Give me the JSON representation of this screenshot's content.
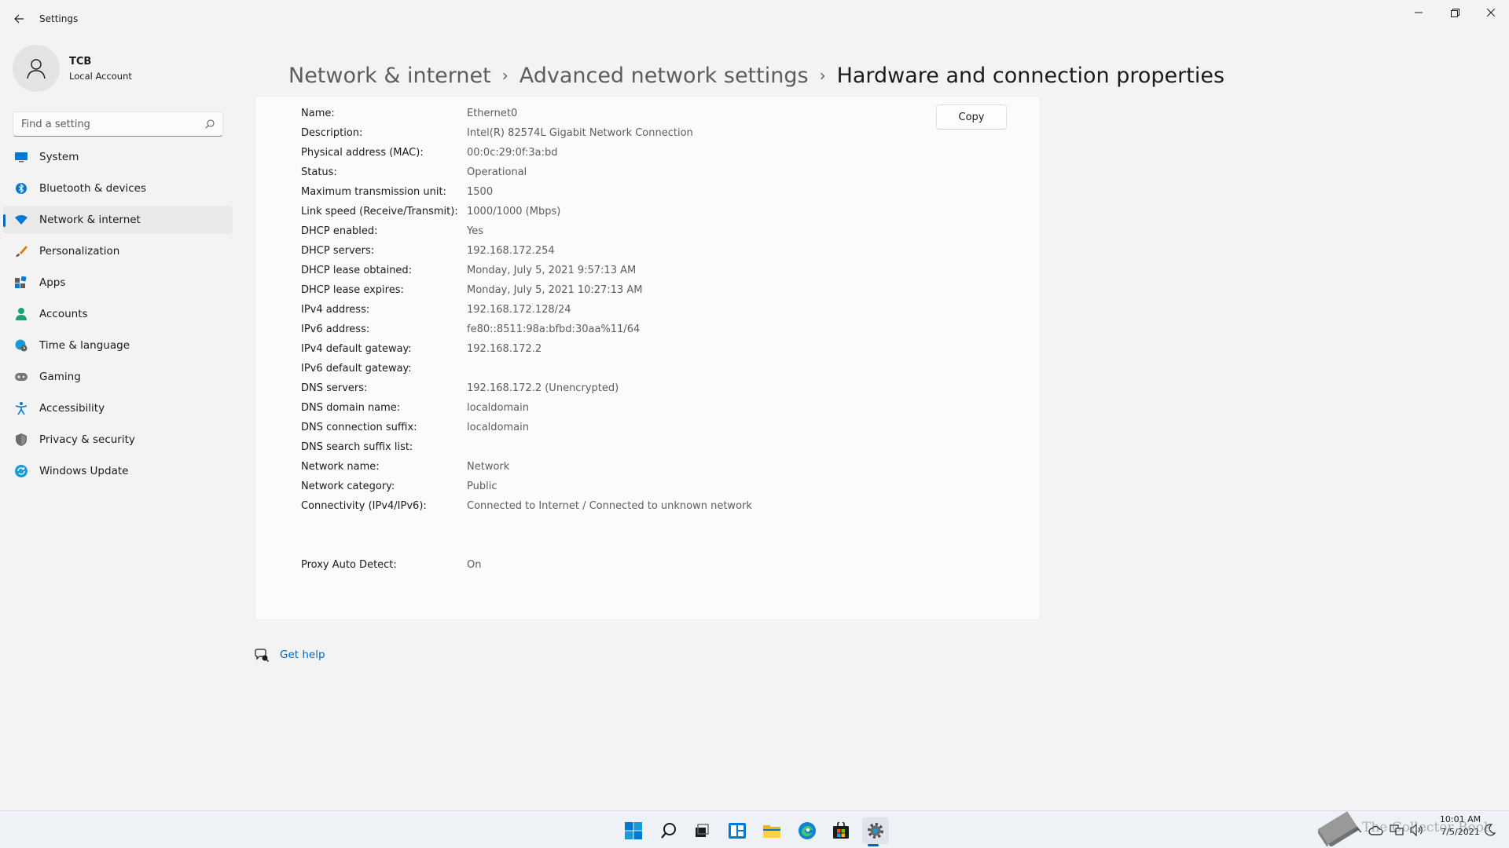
{
  "window": {
    "title": "Settings",
    "colors": {
      "accent": "#0067c0",
      "background": "#f3f3f3",
      "card": "#fbfbfb"
    }
  },
  "profile": {
    "name": "TCB",
    "account_type": "Local Account"
  },
  "search": {
    "placeholder": "Find a setting"
  },
  "sidebar": {
    "items": [
      {
        "label": "System",
        "icon": "monitor-icon"
      },
      {
        "label": "Bluetooth & devices",
        "icon": "bluetooth-icon"
      },
      {
        "label": "Network & internet",
        "icon": "wifi-icon",
        "active": true
      },
      {
        "label": "Personalization",
        "icon": "brush-icon"
      },
      {
        "label": "Apps",
        "icon": "apps-icon"
      },
      {
        "label": "Accounts",
        "icon": "person-icon"
      },
      {
        "label": "Time & language",
        "icon": "globe-clock-icon"
      },
      {
        "label": "Gaming",
        "icon": "gamepad-icon"
      },
      {
        "label": "Accessibility",
        "icon": "accessibility-icon"
      },
      {
        "label": "Privacy & security",
        "icon": "shield-icon"
      },
      {
        "label": "Windows Update",
        "icon": "update-icon"
      }
    ]
  },
  "breadcrumb": {
    "items": [
      "Network & internet",
      "Advanced network settings"
    ],
    "current": "Hardware and connection properties"
  },
  "properties": {
    "copy_label": "Copy",
    "rows": [
      {
        "label": "Name:",
        "value": "Ethernet0"
      },
      {
        "label": "Description:",
        "value": "Intel(R) 82574L Gigabit Network Connection"
      },
      {
        "label": "Physical address (MAC):",
        "value": "00:0c:29:0f:3a:bd"
      },
      {
        "label": "Status:",
        "value": "Operational"
      },
      {
        "label": "Maximum transmission unit:",
        "value": "1500"
      },
      {
        "label": "Link speed (Receive/Transmit):",
        "value": "1000/1000 (Mbps)"
      },
      {
        "label": "DHCP enabled:",
        "value": "Yes"
      },
      {
        "label": "DHCP servers:",
        "value": "192.168.172.254"
      },
      {
        "label": "DHCP lease obtained:",
        "value": "Monday, July 5, 2021 9:57:13 AM"
      },
      {
        "label": "DHCP lease expires:",
        "value": "Monday, July 5, 2021 10:27:13 AM"
      },
      {
        "label": "IPv4 address:",
        "value": "192.168.172.128/24"
      },
      {
        "label": "IPv6 address:",
        "value": "fe80::8511:98a:bfbd:30aa%11/64"
      },
      {
        "label": "IPv4 default gateway:",
        "value": "192.168.172.2"
      },
      {
        "label": "IPv6 default gateway:",
        "value": ""
      },
      {
        "label": "DNS servers:",
        "value": "192.168.172.2 (Unencrypted)"
      },
      {
        "label": "DNS domain name:",
        "value": "localdomain"
      },
      {
        "label": "DNS connection suffix:",
        "value": "localdomain"
      },
      {
        "label": "DNS search suffix list:",
        "value": ""
      },
      {
        "label": "Network name:",
        "value": "Network"
      },
      {
        "label": "Network category:",
        "value": "Public"
      },
      {
        "label": "Connectivity (IPv4/IPv6):",
        "value": "Connected to Internet / Connected to unknown network"
      },
      {
        "label": "",
        "value": ""
      },
      {
        "label": "",
        "value": ""
      },
      {
        "label": "Proxy Auto Detect:",
        "value": "On"
      }
    ]
  },
  "help": {
    "label": "Get help"
  },
  "taskbar": {
    "apps": [
      "start-icon",
      "search-icon",
      "task-view-icon",
      "widgets-icon",
      "file-explorer-icon",
      "edge-icon",
      "store-icon",
      "settings-icon"
    ],
    "clock_time": "10:01 AM",
    "clock_date": "7/5/2021"
  },
  "watermark": {
    "text": "The Collector Book"
  }
}
